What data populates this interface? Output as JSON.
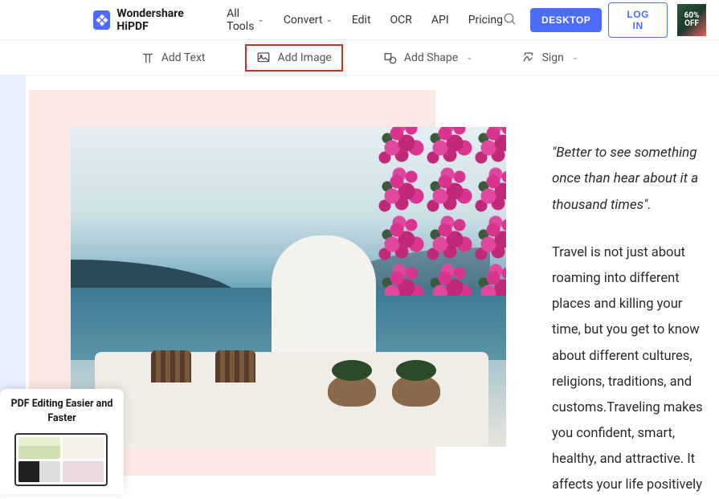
{
  "brand": {
    "name": "Wondershare HiPDF"
  },
  "nav": {
    "all_tools": "All Tools",
    "convert": "Convert",
    "edit": "Edit",
    "ocr": "OCR",
    "api": "API",
    "pricing": "Pricing"
  },
  "header_buttons": {
    "desktop": "DESKTOP",
    "login": "LOG IN"
  },
  "promo_badge": {
    "line1": "60%",
    "line2": "OFF"
  },
  "toolbar": {
    "add_text": "Add Text",
    "add_image": "Add Image",
    "add_shape": "Add Shape",
    "sign": "Sign"
  },
  "document": {
    "quote": "\"Better to see something once than hear about it a thousand times\".",
    "paragraph": "Travel is not just about roaming into different places and killing your time, but you get to know about different cultures, religions, traditions, and customs.Traveling makes you confident, smart, healthy, and attractive. It affects your life positively"
  },
  "float_promo": {
    "title": "PDF Editing Easier and Faster"
  }
}
